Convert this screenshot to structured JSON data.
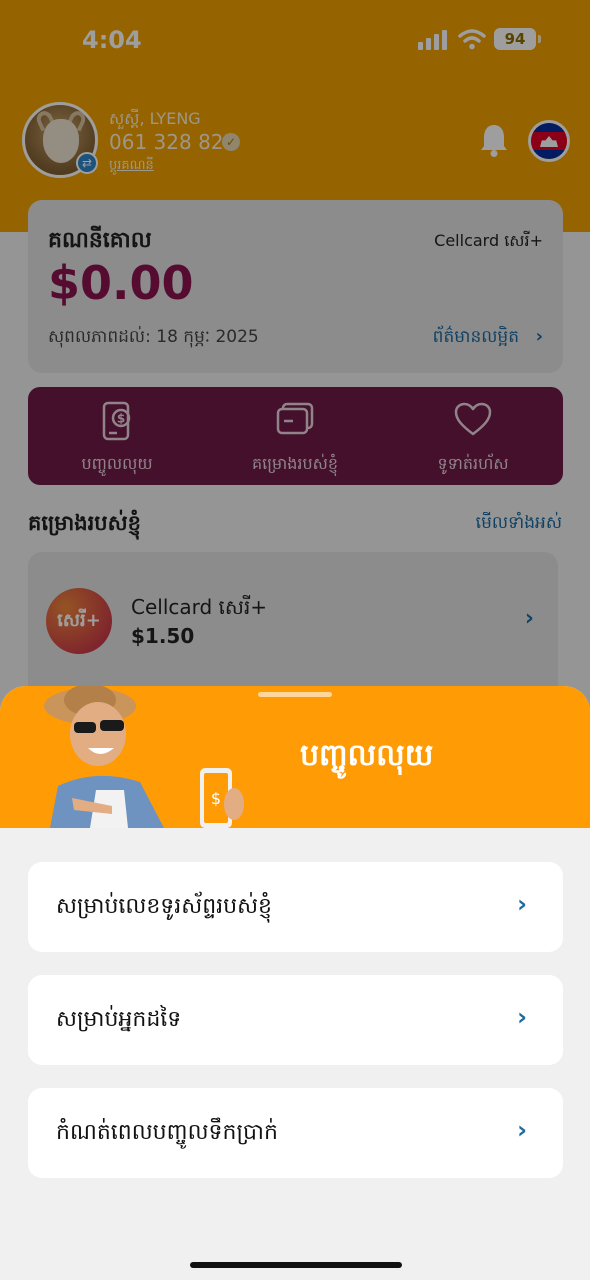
{
  "status_bar": {
    "time": "4:04",
    "battery": "94"
  },
  "profile": {
    "name": "សួស្តី, LYENG",
    "phone": "061 328 822",
    "switch_label": "ប្តូរគណនី"
  },
  "balance": {
    "title": "គណនីគោល",
    "plan": "Cellcard សេរី+",
    "amount": "$0.00",
    "validity": "សុពលភាពដល់: 18 កុម្ភៈ 2025",
    "more_info": "ព័ត៌មានលម្អិត"
  },
  "actions": [
    {
      "label": "បញ្ចូលលុយ",
      "icon": "topup-phone-icon"
    },
    {
      "label": "គម្រោងរបស់ខ្ញុំ",
      "icon": "cards-icon"
    },
    {
      "label": "ទូទាត់រហ័ស",
      "icon": "heart-icon"
    }
  ],
  "my_plans": {
    "title": "គម្រោងរបស់ខ្ញុំ",
    "see_all": "មើលទាំងអស់",
    "items": [
      {
        "logo_text": "សេរី+",
        "name": "Cellcard សេរី+",
        "price": "$1.50"
      }
    ]
  },
  "sheet": {
    "title": "បញ្ចូលលុយ",
    "options": [
      {
        "label": "សម្រាប់លេខទូរស័ព្ទរបស់ខ្ញុំ"
      },
      {
        "label": "សម្រាប់អ្នកដទៃ"
      },
      {
        "label": "កំណត់ពេលបញ្ចូលទឹកប្រាក់"
      }
    ]
  },
  "colors": {
    "header_orange": "#f0a000",
    "sheet_orange": "#ff9b05",
    "brand_magenta": "#8b1250",
    "link_blue": "#1b6aa0"
  }
}
